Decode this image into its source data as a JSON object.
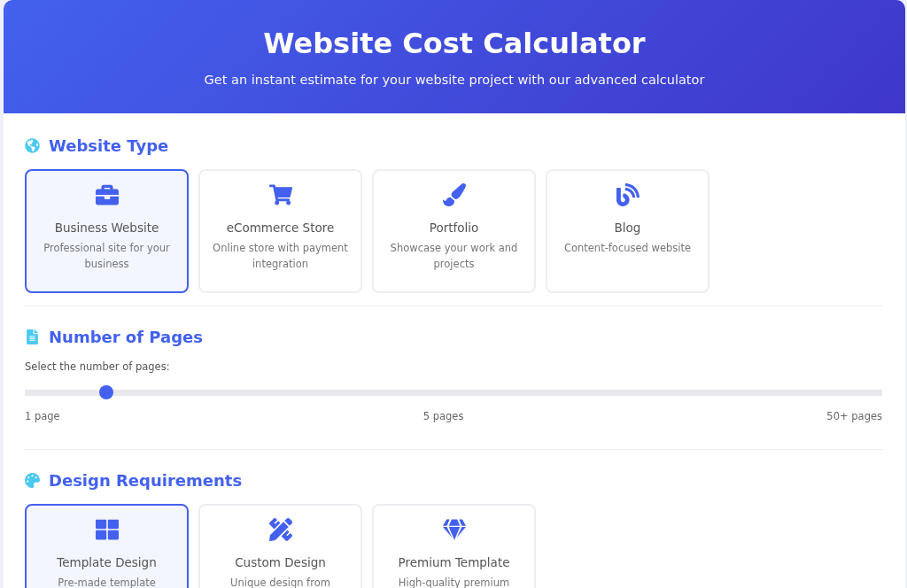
{
  "header": {
    "title": "Website Cost Calculator",
    "subtitle": "Get an instant estimate for your website project with our advanced calculator"
  },
  "website_type": {
    "title": "Website Type",
    "options": [
      {
        "label": "Business Website",
        "description": "Professional site for your business",
        "selected": true
      },
      {
        "label": "eCommerce Store",
        "description": "Online store with payment integration",
        "selected": false
      },
      {
        "label": "Portfolio",
        "description": "Showcase your work and projects",
        "selected": false
      },
      {
        "label": "Blog",
        "description": "Content-focused website",
        "selected": false
      }
    ]
  },
  "pages": {
    "title": "Number of Pages",
    "label": "Select the number of pages:",
    "level": 0.088,
    "ticks": [
      "1 page",
      "5 pages",
      "50+ pages"
    ]
  },
  "design": {
    "title": "Design Requirements",
    "options": [
      {
        "label": "Template Design",
        "description": "Pre-made template",
        "selected": true
      },
      {
        "label": "Custom Design",
        "description": "Unique design from",
        "selected": false
      },
      {
        "label": "Premium Template",
        "description": "High-quality premium",
        "selected": false
      }
    ]
  }
}
